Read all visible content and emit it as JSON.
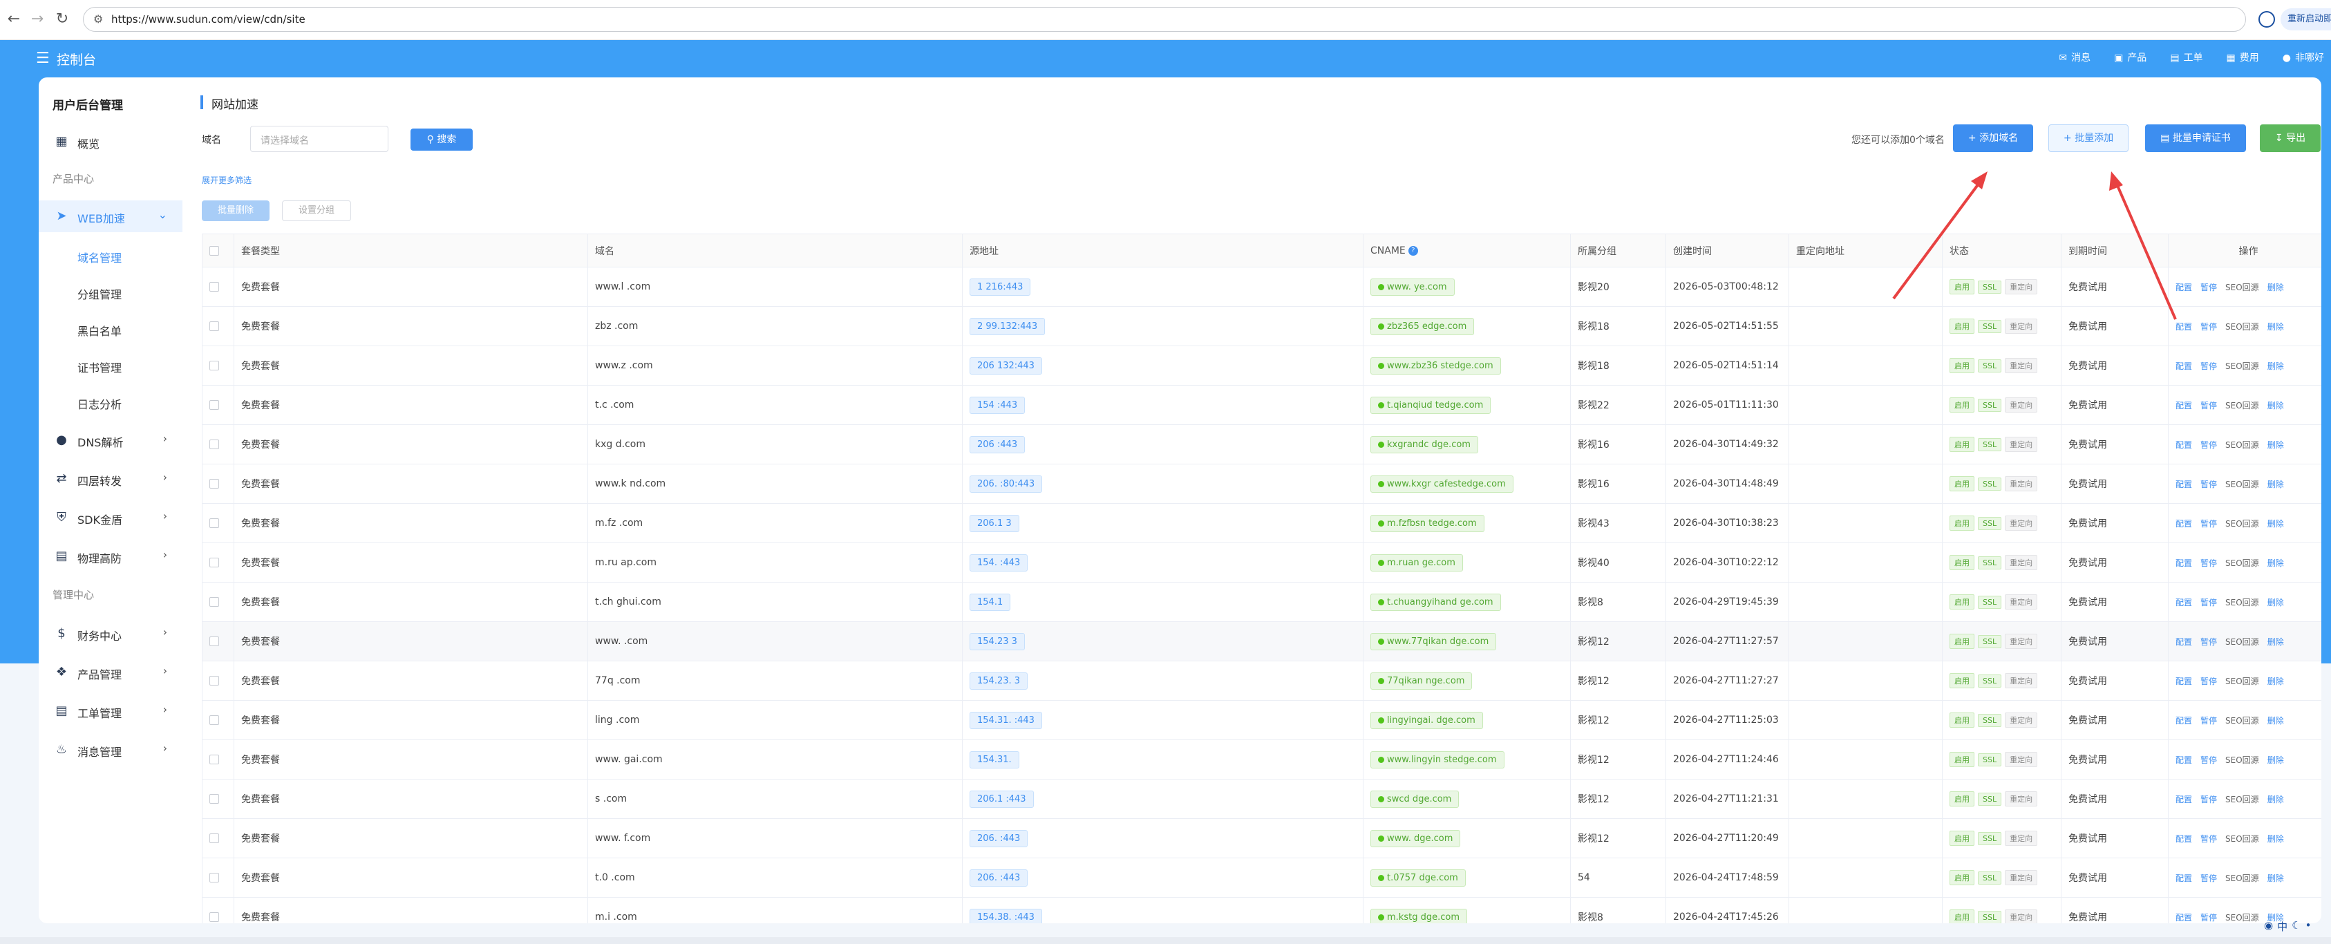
{
  "browser": {
    "url": "https://www.sudun.com/view/cdn/site",
    "update_label": "重新启动即可"
  },
  "header": {
    "title": "控制台",
    "nav": [
      {
        "icon": "mail-icon",
        "label": "消息"
      },
      {
        "icon": "cart-icon",
        "label": "产品"
      },
      {
        "icon": "ticket-icon",
        "label": "工单"
      },
      {
        "icon": "bill-icon",
        "label": "费用"
      },
      {
        "icon": "user-icon",
        "label": "非哪好"
      }
    ]
  },
  "sidebar": {
    "title": "用户后台管理",
    "overview": "概览",
    "section_product": "产品中心",
    "web": "WEB加速",
    "web_subs": [
      "域名管理",
      "分组管理",
      "黑白名单",
      "证书管理",
      "日志分析"
    ],
    "dns": "DNS解析",
    "l4": "四层转发",
    "sdk": "SDK金盾",
    "phys": "物理高防",
    "section_manage": "管理中心",
    "finance": "财务中心",
    "product_mgmt": "产品管理",
    "ticket_mgmt": "工单管理",
    "msg_mgmt": "消息管理"
  },
  "main": {
    "title": "网站加速",
    "filter_label": "域名",
    "filter_placeholder": "请选择域名",
    "search_label": "搜索",
    "expand_label": "展开更多筛选",
    "bulk_delete": "批量删除",
    "set_group": "设置分组",
    "remaining": "您还可以添加0个域名",
    "btn_add": "添加域名",
    "btn_bulk_add": "批量添加",
    "btn_cert": "批量申请证书",
    "btn_export": "导出"
  },
  "table": {
    "headers": [
      "",
      "套餐类型",
      "域名",
      "源地址",
      "CNAME",
      "所属分组",
      "创建时间",
      "重定向地址",
      "状态",
      "到期时间",
      "操作"
    ],
    "status_labels": [
      "启用",
      "SSL",
      "重定向"
    ],
    "op_labels": [
      "配置",
      "暂停",
      "SEO回源",
      "删除"
    ],
    "rows": [
      {
        "plan": "免费套餐",
        "domain": "www.l      .com",
        "src": "1          216:443",
        "cname": "www.            ye.com",
        "group": "影视20",
        "created": "2026-05-03T00:48:12",
        "expire": "免费试用"
      },
      {
        "plan": "免费套餐",
        "domain": "zbz       .com",
        "src": "2        99.132:443",
        "cname": "zbz365             edge.com",
        "group": "影视18",
        "created": "2026-05-02T14:51:55",
        "expire": "免费试用"
      },
      {
        "plan": "免费套餐",
        "domain": "www.z       .com",
        "src": "206       132:443",
        "cname": "www.zbz36           stedge.com",
        "group": "影视18",
        "created": "2026-05-02T14:51:14",
        "expire": "免费试用"
      },
      {
        "plan": "免费套餐",
        "domain": "t.c       .com",
        "src": "154        :443",
        "cname": "t.qianqiud           tedge.com",
        "group": "影视22",
        "created": "2026-05-01T11:11:30",
        "expire": "免费试用"
      },
      {
        "plan": "免费套餐",
        "domain": "kxg        d.com",
        "src": "206        :443",
        "cname": "kxgrandc            dge.com",
        "group": "影视16",
        "created": "2026-04-30T14:49:32",
        "expire": "免费试用"
      },
      {
        "plan": "免费套餐",
        "domain": "www.k        nd.com",
        "src": "206.       :80:443",
        "cname": "www.kxgr           cafestedge.com",
        "group": "影视16",
        "created": "2026-04-30T14:48:49",
        "expire": "免费试用"
      },
      {
        "plan": "免费套餐",
        "domain": "m.fz      .com",
        "src": "206.1            3",
        "cname": "m.fzfbsn            tedge.com",
        "group": "影视43",
        "created": "2026-04-30T10:38:23",
        "expire": "免费试用"
      },
      {
        "plan": "免费套餐",
        "domain": "m.ru         ap.com",
        "src": "154.       :443",
        "cname": "m.ruan              ge.com",
        "group": "影视40",
        "created": "2026-04-30T10:22:12",
        "expire": "免费试用"
      },
      {
        "plan": "免费套餐",
        "domain": "t.ch           ghui.com",
        "src": "154.1          ",
        "cname": "t.chuangyihand              ge.com",
        "group": "影视8",
        "created": "2026-04-29T19:45:39",
        "expire": "免费试用"
      },
      {
        "plan": "免费套餐",
        "domain": "www.        .com",
        "src": "154.23         3",
        "cname": "www.77qikan          dge.com",
        "group": "影视12",
        "created": "2026-04-27T11:27:57",
        "expire": "免费试用"
      },
      {
        "plan": "免费套餐",
        "domain": "77q      .com",
        "src": "154.23.        3",
        "cname": "77qikan            nge.com",
        "group": "影视12",
        "created": "2026-04-27T11:27:27",
        "expire": "免费试用"
      },
      {
        "plan": "免费套餐",
        "domain": "ling       .com",
        "src": "154.31.     :443",
        "cname": "lingyingai.           dge.com",
        "group": "影视12",
        "created": "2026-04-27T11:25:03",
        "expire": "免费试用"
      },
      {
        "plan": "免费套餐",
        "domain": "www.         gai.com",
        "src": "154.31.          ",
        "cname": "www.lingyin          stedge.com",
        "group": "影视12",
        "created": "2026-04-27T11:24:46",
        "expire": "免费试用"
      },
      {
        "plan": "免费套餐",
        "domain": "s       .com",
        "src": "206.1        :443",
        "cname": "swcd          dge.com",
        "group": "影视12",
        "created": "2026-04-27T11:21:31",
        "expire": "免费试用"
      },
      {
        "plan": "免费套餐",
        "domain": "www.      f.com",
        "src": "206.         :443",
        "cname": "www.           dge.com",
        "group": "影视12",
        "created": "2026-04-27T11:20:49",
        "expire": "免费试用"
      },
      {
        "plan": "免费套餐",
        "domain": "t.0        .com",
        "src": "206.         :443",
        "cname": "t.0757         dge.com",
        "group": "54",
        "created": "2026-04-24T17:48:59",
        "expire": "免费试用"
      },
      {
        "plan": "免费套餐",
        "domain": "m.i       .com",
        "src": "154.38.       :443",
        "cname": "m.kstg          dge.com",
        "group": "影视8",
        "created": "2026-04-24T17:45:26",
        "expire": "免费试用"
      }
    ]
  },
  "colors": {
    "primary": "#3d8ef0",
    "header": "#3d9ff6",
    "success": "#5cb85c",
    "arrow": "#e84141"
  }
}
